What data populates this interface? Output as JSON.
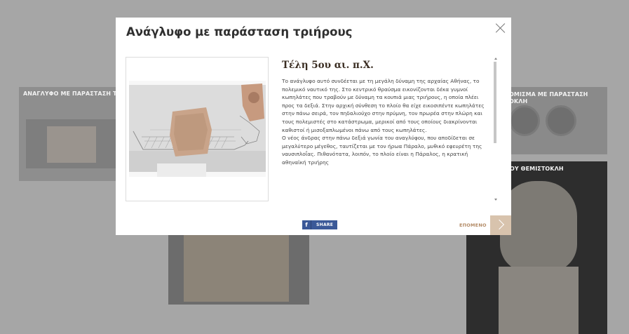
{
  "background": {
    "cards": [
      {
        "caption": "ΑΝΑΓΛΥΦΟ ΜΕ ΠΑΡΑΣΤΑΣΗ Τ"
      },
      {
        "caption": "ΟΜΙΣΜΑ ΜΕ ΠΑΡΑΣΤΑΣΗ\nΟΚΛΗ"
      },
      {
        "caption": "ΟΥ ΘΕΜΙΣΤΟΚΛΗ"
      }
    ]
  },
  "modal": {
    "title": "Ανάγλυφο με παράσταση τριήρους",
    "date_heading": "Τέλη 5ου αι. π.Χ.",
    "paragraphs": [
      "Το ανάγλυφο αυτό συνδέεται με τη μεγάλη δύναμη της αρχαίας Αθήνας, το πολεμικό ναυτικό της. Στο κεντρικό θραύσμα εικονίζονται δέκα γυμνοί κωπηλάτες που τραβούν με δύναμη τα κουπιά μιας τριήρους, η οποία πλέει προς τα δεξιά. Στην αρχική σύνθεση το πλοίο θα είχε εικοσιπέντε κωπηλάτες στην πάνω σειρά, τον πηδαλιούχο στην πρύμνη, τον πρωρέα στην πλώρη και τους πολεμιστές στο κατάστρωμα, μερικοί από τους οποίους διακρίνονται καθιστοί ή μισοξαπλωμένοι πάνω από τους κωπηλάτες.",
      "Ο νέος άνδρας στην πάνω δεξιά γωνία του αναγλύφου, που αποδίδεται σε μεγαλύτερο μέγεθος, ταυτίζεται με τον ήρωα Πάραλο, μυθικό εφευρέτη της ναυσιπλοΐας. Πιθανότατα, λοιπόν, το πλοίο είναι η Πάραλος, η κρατική αθηναϊκή τριήρης"
    ],
    "share": {
      "icon_glyph": "f",
      "label": "SHARE"
    },
    "next_label": "ΕΠΟΜΕΝΟ"
  },
  "icons": {
    "close": "close-icon",
    "facebook": "facebook-icon",
    "next": "chevron-right-icon"
  },
  "colors": {
    "overlay": "#a6a6a6",
    "facebook": "#3b5998",
    "next_button": "#d8c3ad",
    "next_label": "#b38b66"
  }
}
